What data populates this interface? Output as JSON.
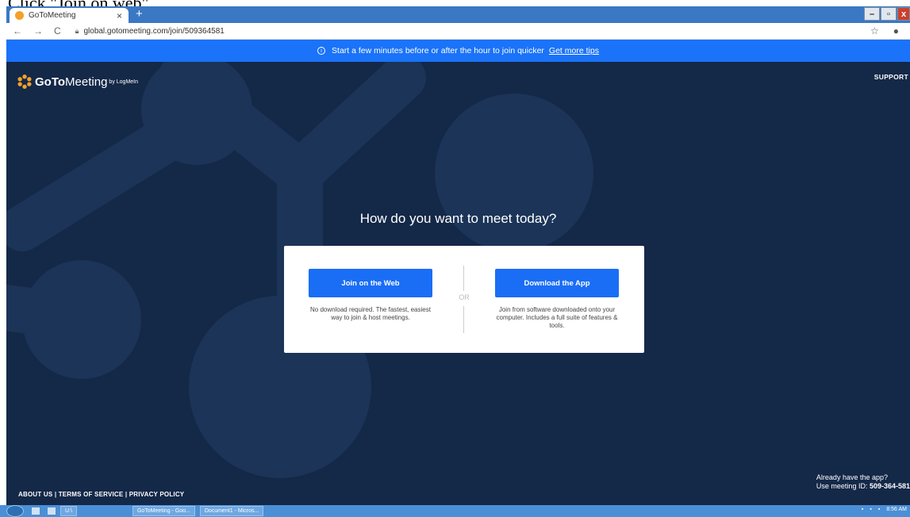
{
  "caption": "Click \"Join on web\".",
  "browser": {
    "tab_title": "GoToMeeting",
    "tab_close": "×",
    "new_tab": "+",
    "url": "global.gotomeeting.com/join/509364581",
    "win_min": "–",
    "win_max": "▫",
    "win_close": "x"
  },
  "banner": {
    "text": "Start a few minutes before or after the hour to join quicker",
    "link": "Get more tips"
  },
  "header": {
    "logo_goto": "GoTo",
    "logo_meeting": "Meeting",
    "logo_by": "by LogMeIn",
    "support": "SUPPORT"
  },
  "main": {
    "headline": "How do you want to meet today?",
    "join_web_button": "Join on the Web",
    "join_web_desc": "No download required. The fastest, easiest way to join & host meetings.",
    "or": "OR",
    "download_app_button": "Download the App",
    "download_app_desc": "Join from software downloaded onto your computer. Includes a full suite of features & tools."
  },
  "already": {
    "line1": "Already have the app?",
    "line2_prefix": "Use meeting ID: ",
    "meeting_id": "509-364-581"
  },
  "footer": {
    "about": "ABOUT US",
    "terms": "TERMS OF SERVICE",
    "privacy": "PRIVACY POLICY",
    "sep": " | "
  },
  "taskbar": {
    "item1": "U:\\",
    "item2": "GoToMeeting - Goo...",
    "item3": "Document1 - Micros...",
    "clock": "8:56 AM"
  },
  "colors": {
    "banner": "#1a73f8",
    "background": "#142848",
    "button": "#1a6ef5",
    "logo_accent": "#f4a02a"
  }
}
